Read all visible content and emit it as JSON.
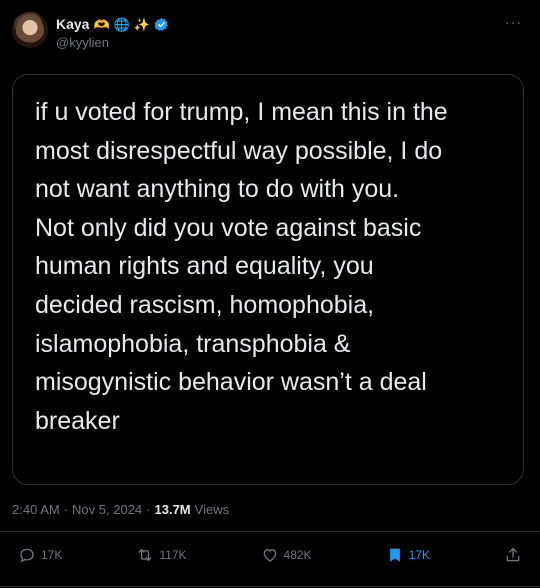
{
  "author": {
    "display_name": "Kaya",
    "handle": "@kyylien",
    "badges": [
      "heart-hands",
      "globe",
      "sparkles",
      "verified"
    ]
  },
  "more_label": "···",
  "tweet": {
    "text": "if u voted for trump, I mean this in the\nmost disrespectful way possible, I do\nnot want anything to do with you.\nNot only did you vote against basic\nhuman rights and equality, you\ndecided rascism, homophobia,\nislamophobia, transphobia &\nmisogynistic behavior wasn’t a deal\nbreaker"
  },
  "meta": {
    "time": "2:40 AM",
    "sep1": "·",
    "date": "Nov 5, 2024",
    "sep2": "·",
    "views_count": "13.7M",
    "views_label": "Views"
  },
  "actions": {
    "replies": "17K",
    "reposts": "117K",
    "likes": "482K",
    "bookmarks": "17K"
  },
  "colors": {
    "background": "#000000",
    "text": "#e7e9ea",
    "muted": "#71767b",
    "accent": "#1d9bf0",
    "border": "#2f3336"
  }
}
